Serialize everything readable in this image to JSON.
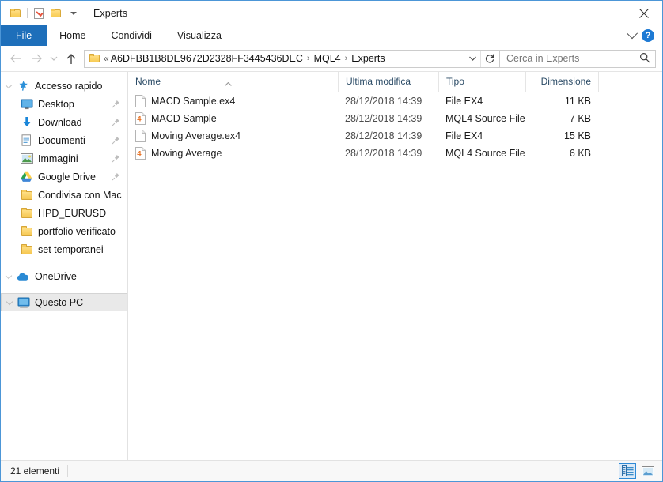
{
  "window": {
    "title": "Experts",
    "quick_access": [
      "folder-icon",
      "properties-icon",
      "new-folder-icon",
      "customize-dropdown-icon"
    ],
    "controls": {
      "minimize": "minimize-icon",
      "maximize": "maximize-icon",
      "close": "close-icon"
    }
  },
  "ribbon": {
    "tabs": [
      {
        "label": "File",
        "active": true
      },
      {
        "label": "Home",
        "active": false
      },
      {
        "label": "Condividi",
        "active": false
      },
      {
        "label": "Visualizza",
        "active": false
      }
    ],
    "expand_icon": "chevron-down-icon",
    "help_icon": "help-icon",
    "help_glyph": "?"
  },
  "address": {
    "back_icon": "arrow-left-icon",
    "forward_icon": "arrow-right-icon",
    "recent_icon": "chevron-down-icon",
    "up_icon": "arrow-up-icon",
    "folder_icon": "folder-icon",
    "leading_separator": "«",
    "crumbs": [
      "A6DFBB1B8DE9672D2328FF3445436DEC",
      "MQL4",
      "Experts"
    ],
    "separator": "›",
    "dropdown_icon": "chevron-down-icon",
    "refresh_icon": "refresh-icon"
  },
  "search": {
    "placeholder": "Cerca in Experts",
    "icon": "search-icon"
  },
  "sidebar": {
    "items": [
      {
        "label": "Accesso rapido",
        "icon": "star-pin-icon",
        "level": "root",
        "expander": true,
        "pinned": false,
        "selected": false
      },
      {
        "label": "Desktop",
        "icon": "desktop-icon",
        "level": "child",
        "expander": false,
        "pinned": true,
        "selected": false
      },
      {
        "label": "Download",
        "icon": "download-icon",
        "level": "child",
        "expander": false,
        "pinned": true,
        "selected": false
      },
      {
        "label": "Documenti",
        "icon": "documents-icon",
        "level": "child",
        "expander": false,
        "pinned": true,
        "selected": false
      },
      {
        "label": "Immagini",
        "icon": "pictures-icon",
        "level": "child",
        "expander": false,
        "pinned": true,
        "selected": false
      },
      {
        "label": "Google Drive",
        "icon": "google-drive-icon",
        "level": "child",
        "expander": false,
        "pinned": true,
        "selected": false
      },
      {
        "label": "Condivisa con Mac",
        "icon": "folder-icon",
        "level": "child",
        "expander": false,
        "pinned": false,
        "selected": false
      },
      {
        "label": "HPD_EURUSD",
        "icon": "folder-icon",
        "level": "child",
        "expander": false,
        "pinned": false,
        "selected": false
      },
      {
        "label": "portfolio verificato",
        "icon": "folder-icon",
        "level": "child",
        "expander": false,
        "pinned": false,
        "selected": false
      },
      {
        "label": "set temporanei",
        "icon": "folder-icon",
        "level": "child",
        "expander": false,
        "pinned": false,
        "selected": false
      },
      {
        "label": "OneDrive",
        "icon": "onedrive-icon",
        "level": "root",
        "expander": true,
        "pinned": false,
        "selected": false
      },
      {
        "label": "Questo PC",
        "icon": "this-pc-icon",
        "level": "root",
        "expander": true,
        "pinned": false,
        "selected": true
      }
    ]
  },
  "filelist": {
    "columns": [
      {
        "label": "Nome",
        "sorted": "asc"
      },
      {
        "label": "Ultima modifica",
        "sorted": ""
      },
      {
        "label": "Tipo",
        "sorted": ""
      },
      {
        "label": "Dimensione",
        "sorted": ""
      }
    ],
    "sort_icon": "sort-ascending-icon",
    "rows": [
      {
        "name": "MACD Sample.ex4",
        "modified": "28/12/2018 14:39",
        "type": "File EX4",
        "size": "11 KB",
        "icon": "ex4-file-icon"
      },
      {
        "name": "MACD Sample",
        "modified": "28/12/2018 14:39",
        "type": "MQL4 Source File",
        "size": "7 KB",
        "icon": "mql4-file-icon"
      },
      {
        "name": "Moving Average.ex4",
        "modified": "28/12/2018 14:39",
        "type": "File EX4",
        "size": "15 KB",
        "icon": "ex4-file-icon"
      },
      {
        "name": "Moving Average",
        "modified": "28/12/2018 14:39",
        "type": "MQL4 Source File",
        "size": "6 KB",
        "icon": "mql4-file-icon"
      }
    ]
  },
  "statusbar": {
    "item_count": "21 elementi",
    "views": [
      {
        "name": "details-view-button",
        "icon": "details-view-icon",
        "active": true
      },
      {
        "name": "large-icons-view-button",
        "icon": "large-icons-view-icon",
        "active": false
      }
    ]
  },
  "colors": {
    "accent": "#1e6fba",
    "window_border": "#4c96d7",
    "header_text": "#2b4b66",
    "mql4_orange": "#e8762b"
  }
}
